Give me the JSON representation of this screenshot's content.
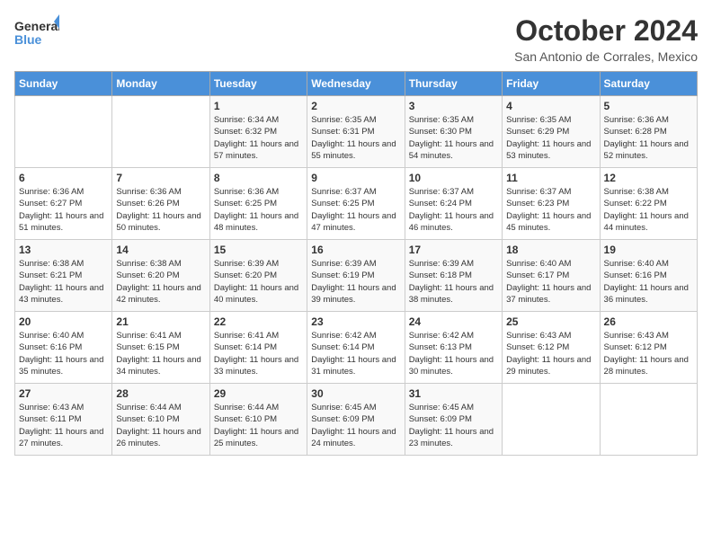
{
  "header": {
    "logo_general": "General",
    "logo_blue": "Blue",
    "month_title": "October 2024",
    "location": "San Antonio de Corrales, Mexico"
  },
  "weekdays": [
    "Sunday",
    "Monday",
    "Tuesday",
    "Wednesday",
    "Thursday",
    "Friday",
    "Saturday"
  ],
  "weeks": [
    [
      {
        "day": "",
        "info": ""
      },
      {
        "day": "",
        "info": ""
      },
      {
        "day": "1",
        "info": "Sunrise: 6:34 AM\nSunset: 6:32 PM\nDaylight: 11 hours and 57 minutes."
      },
      {
        "day": "2",
        "info": "Sunrise: 6:35 AM\nSunset: 6:31 PM\nDaylight: 11 hours and 55 minutes."
      },
      {
        "day": "3",
        "info": "Sunrise: 6:35 AM\nSunset: 6:30 PM\nDaylight: 11 hours and 54 minutes."
      },
      {
        "day": "4",
        "info": "Sunrise: 6:35 AM\nSunset: 6:29 PM\nDaylight: 11 hours and 53 minutes."
      },
      {
        "day": "5",
        "info": "Sunrise: 6:36 AM\nSunset: 6:28 PM\nDaylight: 11 hours and 52 minutes."
      }
    ],
    [
      {
        "day": "6",
        "info": "Sunrise: 6:36 AM\nSunset: 6:27 PM\nDaylight: 11 hours and 51 minutes."
      },
      {
        "day": "7",
        "info": "Sunrise: 6:36 AM\nSunset: 6:26 PM\nDaylight: 11 hours and 50 minutes."
      },
      {
        "day": "8",
        "info": "Sunrise: 6:36 AM\nSunset: 6:25 PM\nDaylight: 11 hours and 48 minutes."
      },
      {
        "day": "9",
        "info": "Sunrise: 6:37 AM\nSunset: 6:25 PM\nDaylight: 11 hours and 47 minutes."
      },
      {
        "day": "10",
        "info": "Sunrise: 6:37 AM\nSunset: 6:24 PM\nDaylight: 11 hours and 46 minutes."
      },
      {
        "day": "11",
        "info": "Sunrise: 6:37 AM\nSunset: 6:23 PM\nDaylight: 11 hours and 45 minutes."
      },
      {
        "day": "12",
        "info": "Sunrise: 6:38 AM\nSunset: 6:22 PM\nDaylight: 11 hours and 44 minutes."
      }
    ],
    [
      {
        "day": "13",
        "info": "Sunrise: 6:38 AM\nSunset: 6:21 PM\nDaylight: 11 hours and 43 minutes."
      },
      {
        "day": "14",
        "info": "Sunrise: 6:38 AM\nSunset: 6:20 PM\nDaylight: 11 hours and 42 minutes."
      },
      {
        "day": "15",
        "info": "Sunrise: 6:39 AM\nSunset: 6:20 PM\nDaylight: 11 hours and 40 minutes."
      },
      {
        "day": "16",
        "info": "Sunrise: 6:39 AM\nSunset: 6:19 PM\nDaylight: 11 hours and 39 minutes."
      },
      {
        "day": "17",
        "info": "Sunrise: 6:39 AM\nSunset: 6:18 PM\nDaylight: 11 hours and 38 minutes."
      },
      {
        "day": "18",
        "info": "Sunrise: 6:40 AM\nSunset: 6:17 PM\nDaylight: 11 hours and 37 minutes."
      },
      {
        "day": "19",
        "info": "Sunrise: 6:40 AM\nSunset: 6:16 PM\nDaylight: 11 hours and 36 minutes."
      }
    ],
    [
      {
        "day": "20",
        "info": "Sunrise: 6:40 AM\nSunset: 6:16 PM\nDaylight: 11 hours and 35 minutes."
      },
      {
        "day": "21",
        "info": "Sunrise: 6:41 AM\nSunset: 6:15 PM\nDaylight: 11 hours and 34 minutes."
      },
      {
        "day": "22",
        "info": "Sunrise: 6:41 AM\nSunset: 6:14 PM\nDaylight: 11 hours and 33 minutes."
      },
      {
        "day": "23",
        "info": "Sunrise: 6:42 AM\nSunset: 6:14 PM\nDaylight: 11 hours and 31 minutes."
      },
      {
        "day": "24",
        "info": "Sunrise: 6:42 AM\nSunset: 6:13 PM\nDaylight: 11 hours and 30 minutes."
      },
      {
        "day": "25",
        "info": "Sunrise: 6:43 AM\nSunset: 6:12 PM\nDaylight: 11 hours and 29 minutes."
      },
      {
        "day": "26",
        "info": "Sunrise: 6:43 AM\nSunset: 6:12 PM\nDaylight: 11 hours and 28 minutes."
      }
    ],
    [
      {
        "day": "27",
        "info": "Sunrise: 6:43 AM\nSunset: 6:11 PM\nDaylight: 11 hours and 27 minutes."
      },
      {
        "day": "28",
        "info": "Sunrise: 6:44 AM\nSunset: 6:10 PM\nDaylight: 11 hours and 26 minutes."
      },
      {
        "day": "29",
        "info": "Sunrise: 6:44 AM\nSunset: 6:10 PM\nDaylight: 11 hours and 25 minutes."
      },
      {
        "day": "30",
        "info": "Sunrise: 6:45 AM\nSunset: 6:09 PM\nDaylight: 11 hours and 24 minutes."
      },
      {
        "day": "31",
        "info": "Sunrise: 6:45 AM\nSunset: 6:09 PM\nDaylight: 11 hours and 23 minutes."
      },
      {
        "day": "",
        "info": ""
      },
      {
        "day": "",
        "info": ""
      }
    ]
  ]
}
